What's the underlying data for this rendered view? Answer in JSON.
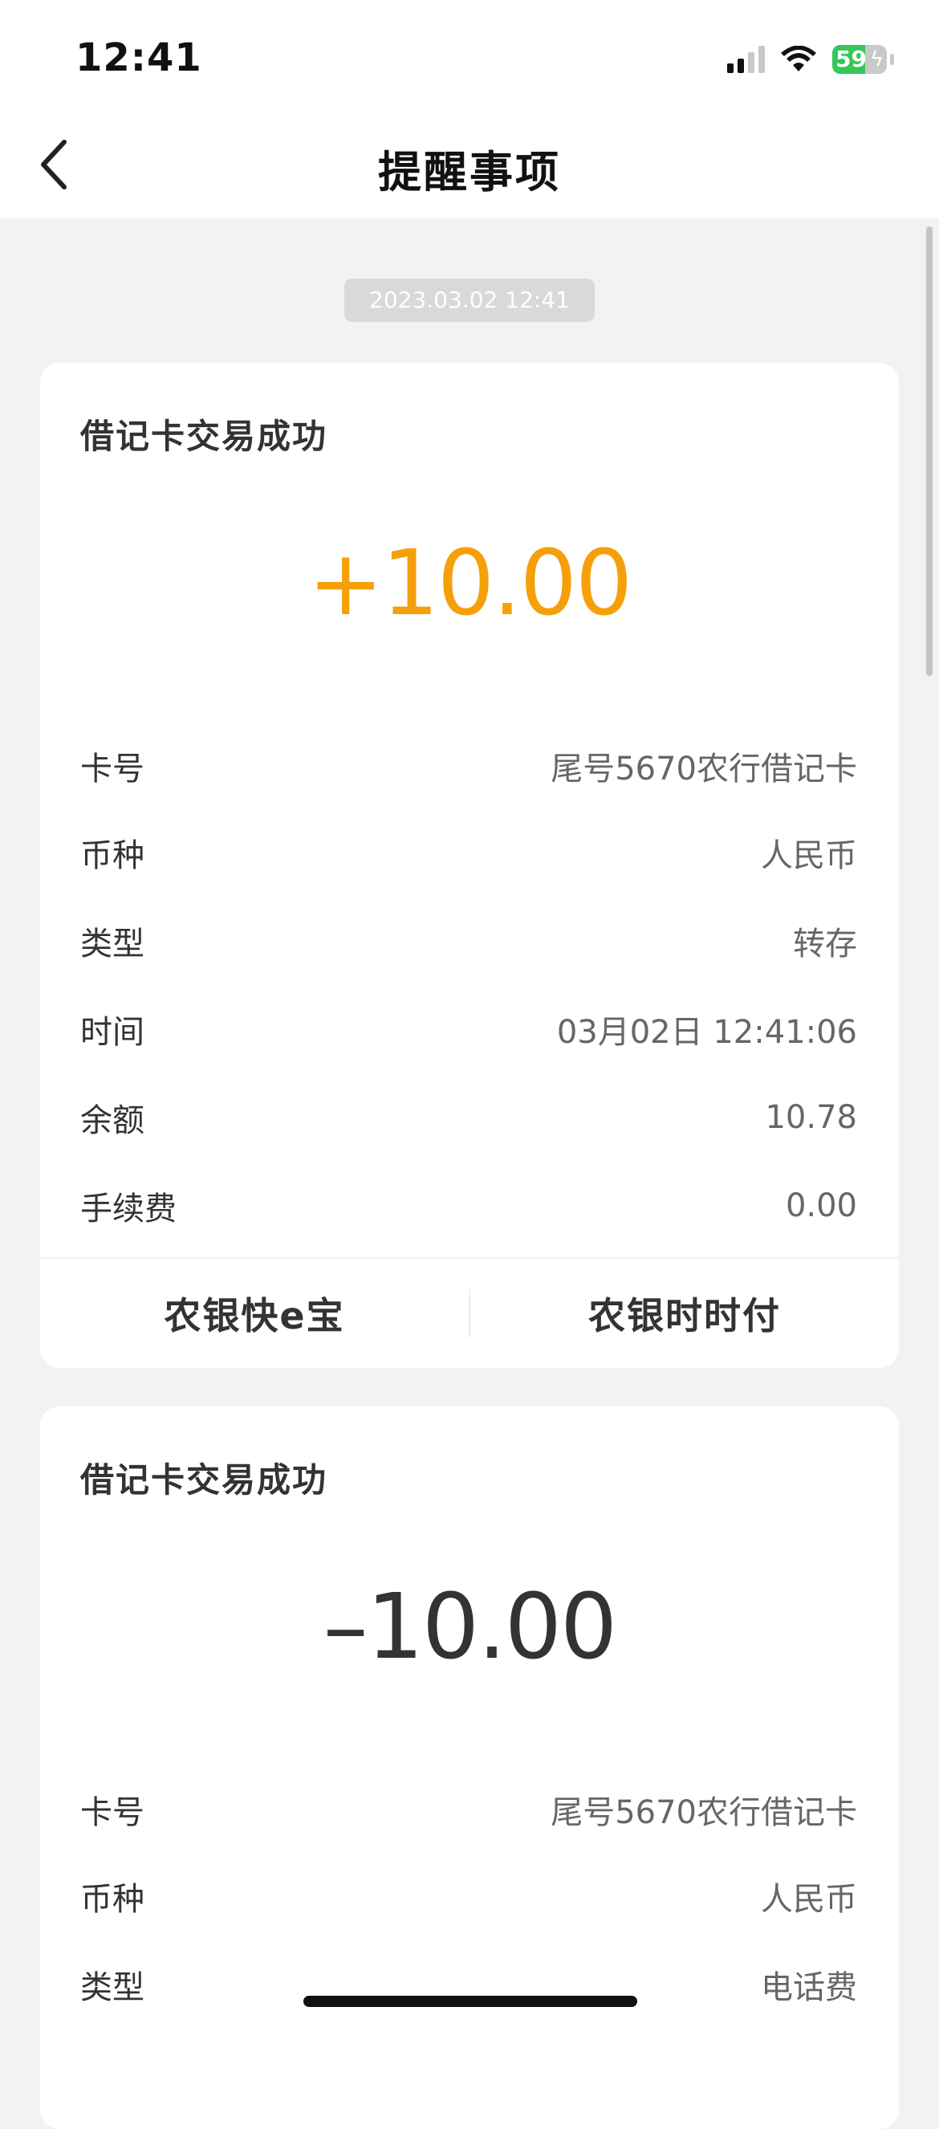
{
  "status_bar": {
    "time": "12:41",
    "battery_pct": "59"
  },
  "nav": {
    "title": "提醒事项"
  },
  "date_stamp": "2023.03.02 12:41",
  "cards": [
    {
      "title": "借记卡交易成功",
      "amount": "+10.00",
      "rows": [
        {
          "label": "卡号",
          "value": "尾号5670农行借记卡"
        },
        {
          "label": "币种",
          "value": "人民币"
        },
        {
          "label": "类型",
          "value": "转存"
        },
        {
          "label": "时间",
          "value": "03月02日 12:41:06"
        },
        {
          "label": "余额",
          "value": "10.78"
        },
        {
          "label": "手续费",
          "value": "0.00"
        }
      ],
      "actions": [
        "农银快e宝",
        "农银时时付"
      ]
    },
    {
      "title": "借记卡交易成功",
      "amount": "–10.00",
      "rows": [
        {
          "label": "卡号",
          "value": "尾号5670农行借记卡"
        },
        {
          "label": "币种",
          "value": "人民币"
        },
        {
          "label": "类型",
          "value": "电话费"
        }
      ]
    }
  ],
  "colors": {
    "positive_amount": "#f5a00a",
    "negative_amount": "#333333",
    "page_bg": "#f2f2f2",
    "battery_green": "#34c759"
  }
}
